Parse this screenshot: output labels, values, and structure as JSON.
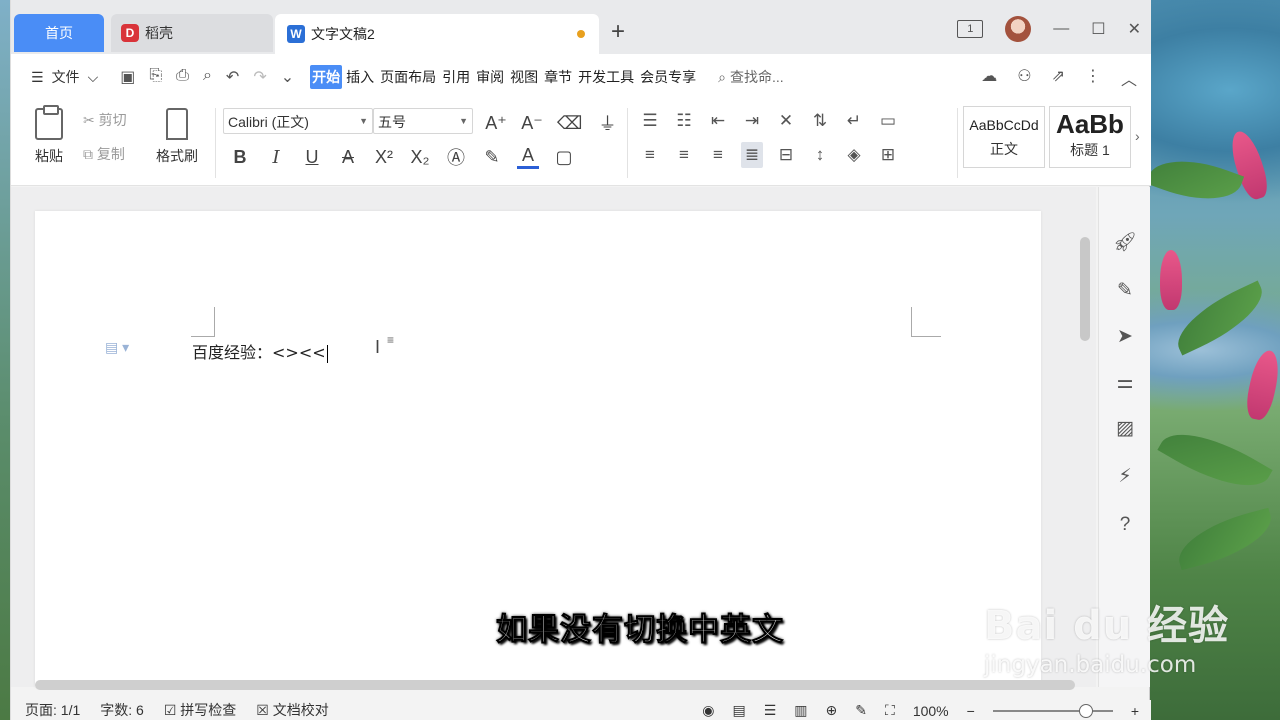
{
  "tabs": {
    "home": "首页",
    "docer": "稻壳",
    "docer_logo": "D",
    "doc": "文字文稿2",
    "doc_logo": "W",
    "add": "+",
    "mini_page": "1"
  },
  "menu": {
    "file": "文件",
    "tabs": [
      "开始",
      "插入",
      "页面布局",
      "引用",
      "审阅",
      "视图",
      "章节",
      "开发工具",
      "会员专享"
    ],
    "search": "查找命..."
  },
  "ribbon": {
    "paste": "粘贴",
    "cut": "剪切",
    "copy": "复制",
    "format_painter": "格式刷",
    "font_name": "Calibri (正文)",
    "font_size": "五号",
    "styles": [
      {
        "sample": "AaBbCcDd",
        "name": "正文"
      },
      {
        "sample": "AaBb",
        "name": "标题 1"
      }
    ]
  },
  "document": {
    "text": "百度经验：<><<"
  },
  "status": {
    "page": "页面: 1/1",
    "words": "字数: 6",
    "spell": "拼写检查",
    "proof": "文档校对",
    "zoom": "100%"
  },
  "overlay": {
    "subtitle": "如果没有切换中英文",
    "wm_brand": "Bai du 经验",
    "wm_url": "jingyan.baidu.com"
  },
  "colors": {
    "accent": "#4a8df6",
    "unsaved": "#e8a01e",
    "docer": "#d9343a",
    "wps": "#2b6fd6"
  }
}
